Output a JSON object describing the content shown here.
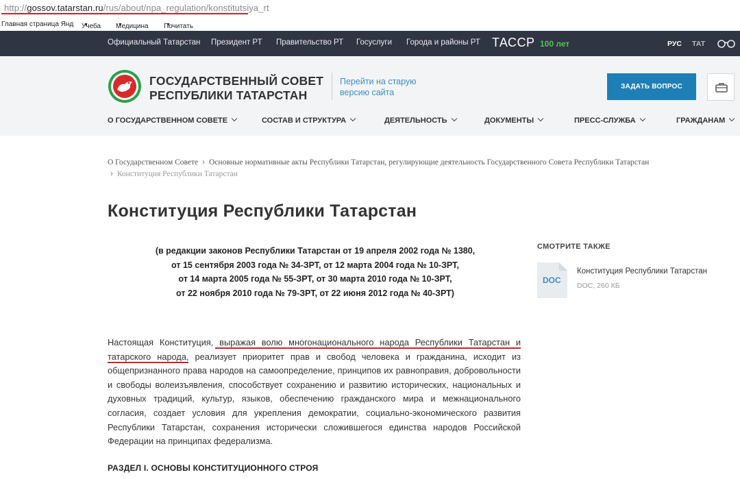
{
  "browser": {
    "url_scheme": "http://",
    "url_host": "gossov.tatarstan.ru",
    "url_path": "/rus/about/npa_regulation/konstitutsiya_rt",
    "bookmarks": [
      "Главная страница Янд",
      "Учеба",
      "Медицина",
      "Почитать"
    ]
  },
  "topnav": {
    "items": [
      "Официальный Татарстан",
      "Президент РТ",
      "Правительство РТ",
      "Госуслуги",
      "Города и районы РТ"
    ],
    "tass": "ТАССР",
    "tass_100": "100 лет",
    "lang_ru": "РУС",
    "lang_tat": "ТАТ"
  },
  "header": {
    "org_line1": "ГОСУДАРСТВЕННЫЙ СОВЕТ",
    "org_line2": "РЕСПУБЛИКИ ТАТАРСТАН",
    "oldsite_line1": "Перейти на старую",
    "oldsite_line2": "версию сайта",
    "ask_button": "ЗАДАТЬ ВОПРОС"
  },
  "mainnav": [
    "О ГОСУДАРСТВЕННОМ СОВЕТЕ",
    "СОСТАВ И СТРУКТУРА",
    "ДЕЯТЕЛЬНОСТЬ",
    "ДОКУМЕНТЫ",
    "ПРЕСС-СЛУЖБА",
    "ГРАЖДАНАМ"
  ],
  "breadcrumb": {
    "item1": "О Государственном Совете",
    "item2": "Основные нормативные акты Республики Татарстан, регулирующие деятельность Государственного Совета Республики Татарстан",
    "current": "Конституция Республики Татарстан"
  },
  "page": {
    "title": "Конституция Республики Татарстан",
    "redactions": [
      "(в редакции законов Республики Татарстан от 19 апреля 2002 года № 1380,",
      "от 15 сентября 2003 года № 34-ЗРТ, от 12 марта 2004 года № 10-ЗРТ,",
      "от 14 марта 2005 года № 55-ЗРТ, от 30 марта 2010 года № 10-ЗРТ,",
      "от 22 ноября 2010 года № 79-ЗРТ, от 22 июня 2012 года № 40-ЗРТ)"
    ],
    "preamble_start": "Настоящая Конституция, ",
    "preamble_highlight": "выражая волю многонационального народа Республики Татарстан и татарского народа",
    "preamble_rest": ", реализует приоритет прав и свобод человека и гражданина, исходит из общепризнанного права народов на самоопределение, принципов их равноправия, добровольности и свободы волеизъявления, способствует сохранению и развитию исторических, национальных и духовных традиций, культур, языков, обеспечению гражданского мира и межнационального согласия, создает условия для укрепления демократии, социально-экономического развития Республики Татарстан, сохранения исторически сложившегося единства народов Российской Федерации на принципах федерализма.",
    "section": "РАЗДЕЛ I. ОСНОВЫ КОНСТИТУЦИОННОГО СТРОЯ"
  },
  "seealso": {
    "heading": "СМОТРИТЕ ТАКЖЕ",
    "doc_badge": "DOC",
    "doc_title": "Конституция Республики Татарстан",
    "doc_meta": "DOC, 260 КБ"
  },
  "colors": {
    "topnav_bg": "#2f3542",
    "header_bg": "#f3f4f6",
    "accent_blue": "#1d7fb6",
    "highlight_red": "#c8232c",
    "emblem_green": "#2aa14a"
  }
}
